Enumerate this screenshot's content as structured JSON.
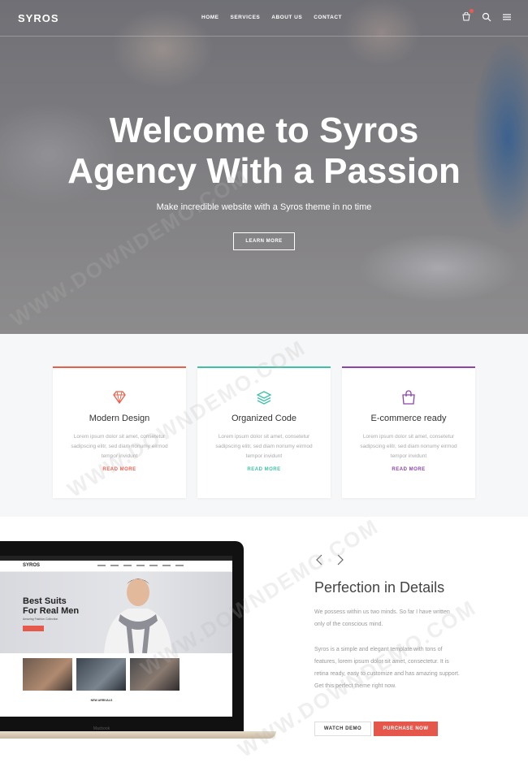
{
  "header": {
    "logo": "SYROS",
    "menu": [
      "HOME",
      "SERVICES",
      "ABOUT US",
      "CONTACT"
    ],
    "icons": [
      "cart-icon",
      "search-icon",
      "menu-icon"
    ]
  },
  "hero": {
    "title_line1": "Welcome to Syros",
    "title_line2": "Agency With a Passion",
    "subtitle": "Make incredible website with a Syros theme in no time",
    "button": "LEARN MORE"
  },
  "features": [
    {
      "title": "Modern Design",
      "text": "Lorem ipsum dolor sit amet, consetetur sadipscing elitr, sed diam nonumy eirmod tempor invidunt",
      "link": "READ MORE",
      "color": "#e8604c",
      "icon": "diamond-icon"
    },
    {
      "title": "Organized Code",
      "text": "Lorem ipsum dolor sit amet, consetetur sadipscing elitr, sed diam nonumy eirmod tempor invidunt",
      "link": "READ MORE",
      "color": "#3ec1a7",
      "icon": "layers-icon"
    },
    {
      "title": "E-commerce ready",
      "text": "Lorem ipsum dolor sit amet, consetetur sadipscing elitr, sed diam nonumy eirmod tempor invidunt",
      "link": "READ MORE",
      "color": "#8e44ad",
      "icon": "shopping-bag-icon"
    }
  ],
  "showcase": {
    "laptop": {
      "logo": "SYROS",
      "headline_line1": "Best Suits",
      "headline_line2": "For Real Men",
      "tagline": "Amazing Fashion Collection",
      "new_arrivals": "NEW ARRIVALS",
      "label": "Macbook"
    },
    "title": "Perfection in Details",
    "paragraph1": "We possess within us two minds. So far I have written only of the conscious mind.",
    "paragraph2": "Syros is a simple and elegant template with tons of features, lorem ipsum dolor sit amet, consectetur. It is retina ready, easy to customize and has amazing support. Get this perfect theme right now.",
    "watch_button": "WATCH DEMO",
    "purchase_button": "PURCHASE NOW"
  },
  "watermark": "WWW.DOWNDEMO.COM"
}
